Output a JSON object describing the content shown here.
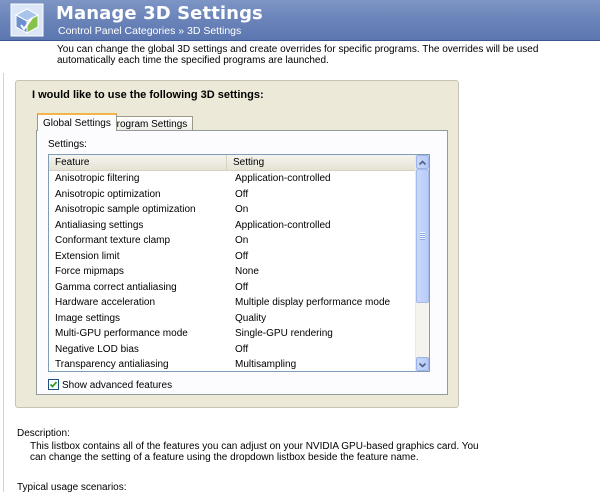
{
  "header": {
    "title": "Manage 3D Settings",
    "breadcrumb": "Control Panel Categories  »  3D Settings",
    "icon": "nvidia-3d-cube-icon"
  },
  "intro_text": "You can change the global 3D settings and create overrides for specific programs. The overrides will be used automatically each time the specified programs are launched.",
  "panel": {
    "heading": "I would like to use the following 3D settings:",
    "tabs": [
      {
        "label": "Global Settings",
        "selected": true
      },
      {
        "label": "Program Settings",
        "selected": false
      }
    ],
    "settings_label": "Settings:",
    "columns": {
      "feature": "Feature",
      "setting": "Setting"
    },
    "rows": [
      {
        "feature": "Anisotropic filtering",
        "setting": "Application-controlled"
      },
      {
        "feature": "Anisotropic optimization",
        "setting": "Off"
      },
      {
        "feature": "Anisotropic sample optimization",
        "setting": "On"
      },
      {
        "feature": "Antialiasing settings",
        "setting": "Application-controlled"
      },
      {
        "feature": "Conformant texture clamp",
        "setting": "On"
      },
      {
        "feature": "Extension limit",
        "setting": "Off"
      },
      {
        "feature": "Force mipmaps",
        "setting": "None"
      },
      {
        "feature": "Gamma correct antialiasing",
        "setting": "Off"
      },
      {
        "feature": "Hardware acceleration",
        "setting": "Multiple display performance mode"
      },
      {
        "feature": "Image settings",
        "setting": "Quality"
      },
      {
        "feature": "Multi-GPU performance mode",
        "setting": "Single-GPU rendering"
      },
      {
        "feature": "Negative LOD bias",
        "setting": "Off"
      },
      {
        "feature": "Transparency antialiasing",
        "setting": "Multisampling"
      }
    ],
    "show_advanced": {
      "label": "Show advanced features",
      "checked": true
    }
  },
  "description": {
    "label": "Description:",
    "text": "This listbox contains all of the features you can adjust on your NVIDIA GPU-based graphics card. You can change the setting of a feature using the dropdown listbox beside the feature name."
  },
  "usage_label": "Typical usage scenarios:",
  "colors": {
    "header_bg": "#6a83b9",
    "panel_bg": "#ece9d8",
    "tab_accent": "#f4b449",
    "list_border": "#7f9db9",
    "scrollbar": "#c1d3fb"
  }
}
